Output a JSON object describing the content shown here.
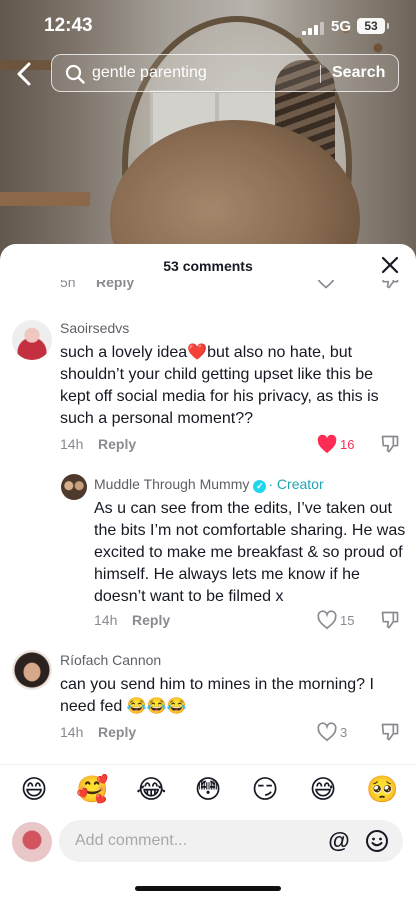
{
  "status_bar": {
    "time": "12:43",
    "network": "5G",
    "battery": "53"
  },
  "search": {
    "query": "gentle parenting",
    "button_label": "Search"
  },
  "comments_panel": {
    "title": "53 comments",
    "partial_row": {
      "time": "5h",
      "reply_label": "Reply"
    },
    "comments": [
      {
        "username": "Saoirsedvs",
        "text": "such a lovely idea❤️but also no hate, but shouldn’t your child getting upset like this be kept off social media for his privacy, as this is such a personal moment??",
        "time": "14h",
        "reply_label": "Reply",
        "likes": "16",
        "liked": true
      },
      {
        "username": "Muddle Through Mummy",
        "creator_label": "· Creator",
        "text": "As u can see from the edits, I’ve taken out the bits I’m not comfortable sharing. He was excited to make me breakfast & so proud of himself. He always lets me know if he doesn’t want to be filmed x",
        "time": "14h",
        "reply_label": "Reply",
        "likes": "15",
        "liked": false
      },
      {
        "username": "Ríofach Cannon",
        "text": "can you send him to mines in the morning? I need fed 😂😂😂",
        "time": "14h",
        "reply_label": "Reply",
        "likes": "3",
        "liked": false
      }
    ]
  },
  "emoji_bar": [
    "😄",
    "🥰",
    "😂",
    "😳",
    "😏",
    "😅",
    "🥺"
  ],
  "input": {
    "placeholder": "Add comment...",
    "at_symbol": "@"
  },
  "colors": {
    "like_red": "#fe2c55",
    "creator_teal": "#22a3b5",
    "verified_blue": "#20d5ec"
  }
}
